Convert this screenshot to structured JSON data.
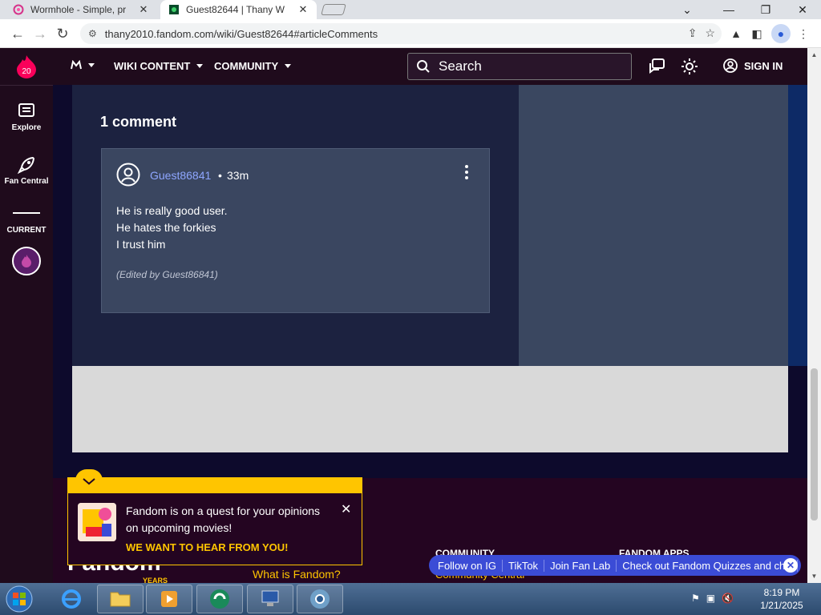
{
  "browser": {
    "tabs": [
      {
        "title": "Wormhole - Simple, pr",
        "active": false
      },
      {
        "title": "Guest82644 | Thany W",
        "active": true
      }
    ],
    "url": "thany2010.fandom.com/wiki/Guest82644#articleComments"
  },
  "left_nav": {
    "logo_text": "20",
    "explore_label": "Explore",
    "fan_central_label": "Fan Central",
    "current_label": "CURRENT"
  },
  "top_nav": {
    "wiki_content_label": "WIKI CONTENT",
    "community_label": "COMMUNITY",
    "search_placeholder": "Search",
    "sign_in_label": "SIGN IN"
  },
  "comments": {
    "count_label": "1 comment",
    "items": [
      {
        "author": "Guest86841",
        "separator": "•",
        "time": "33m",
        "lines": [
          "He is really good user.",
          "He hates the forkies",
          "I trust him"
        ],
        "edited": "(Edited by Guest86841)"
      }
    ]
  },
  "popup": {
    "text": "Fandom is on a quest for your opinions on upcoming movies!",
    "cta": "WE WANT TO HEAR FROM YOU!"
  },
  "footer": {
    "brand": "Fandom",
    "years": "YEARS",
    "what_is": "What is Fandom?",
    "community_heading": "COMMUNITY",
    "community_central": "Community Central",
    "apps_heading": "FANDOM APPS"
  },
  "ticker": {
    "items": [
      "Follow on IG",
      "TikTok",
      "Join Fan Lab",
      "Check out Fandom Quizzes and cha"
    ]
  },
  "taskbar": {
    "time": "8:19 PM",
    "date": "1/21/2025"
  },
  "colors": {
    "fandom_dark": "#1f0b1c",
    "comment_bg": "#3a4660",
    "accent_yellow": "#ffc500",
    "link_blue": "#8ea6ff"
  }
}
